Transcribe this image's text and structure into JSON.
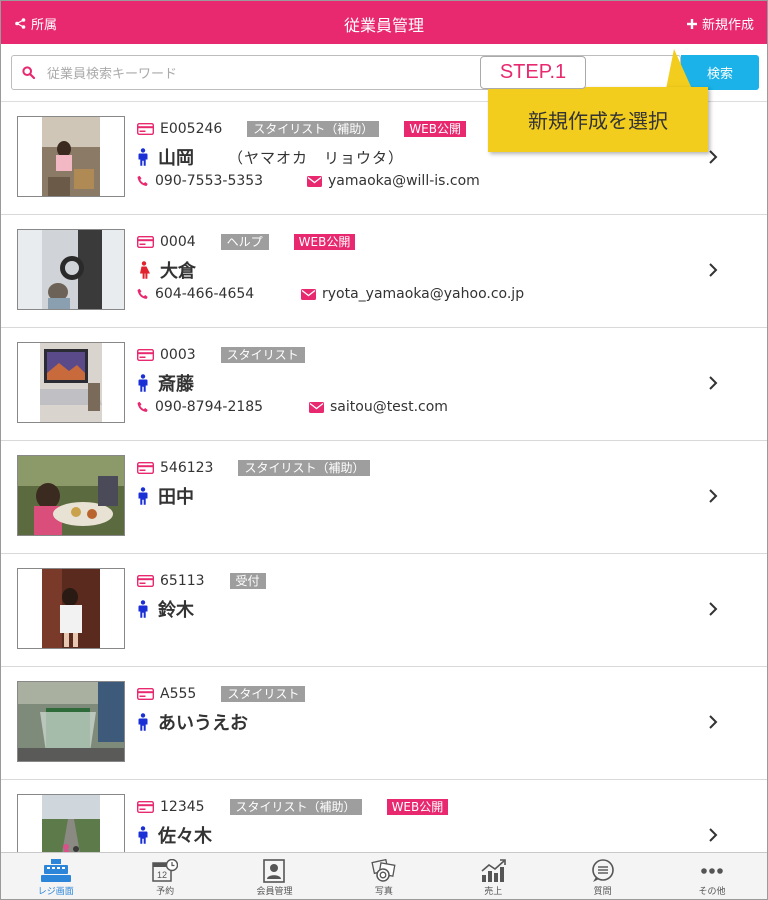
{
  "header": {
    "left_label": "所属",
    "title": "従業員管理",
    "right_label": "新規作成"
  },
  "search": {
    "placeholder": "従業員検索キーワード",
    "button_label": "検索"
  },
  "tutorial": {
    "step": "STEP.1",
    "message": "新規作成を選択"
  },
  "employees": [
    {
      "code": "E005246",
      "role": "スタイリスト（補助）",
      "web": "WEB公開",
      "gender": "male",
      "name": "山岡",
      "kana": "（ヤマオカ　リョウタ）",
      "phone": "090-7553-5353",
      "email": "yamaoka@will-is.com"
    },
    {
      "code": "0004",
      "role": "ヘルプ",
      "web": "WEB公開",
      "gender": "female",
      "name": "大倉",
      "kana": "",
      "phone": "604-466-4654",
      "email": "ryota_yamaoka@yahoo.co.jp"
    },
    {
      "code": "0003",
      "role": "スタイリスト",
      "web": "",
      "gender": "male",
      "name": "斎藤",
      "kana": "",
      "phone": "090-8794-2185",
      "email": "saitou@test.com"
    },
    {
      "code": "546123",
      "role": "スタイリスト（補助）",
      "web": "",
      "gender": "male",
      "name": "田中",
      "kana": "",
      "phone": "",
      "email": ""
    },
    {
      "code": "65113",
      "role": "受付",
      "web": "",
      "gender": "male",
      "name": "鈴木",
      "kana": "",
      "phone": "",
      "email": ""
    },
    {
      "code": "A555",
      "role": "スタイリスト",
      "web": "",
      "gender": "male",
      "name": "あいうえお",
      "kana": "",
      "phone": "",
      "email": ""
    },
    {
      "code": "12345",
      "role": "スタイリスト（補助）",
      "web": "WEB公開",
      "gender": "male",
      "name": "佐々木",
      "kana": "",
      "phone": "",
      "email": ""
    }
  ],
  "bottom_nav": [
    {
      "label": "レジ画面",
      "icon": "register-icon",
      "active": true
    },
    {
      "label": "予約",
      "icon": "calendar-icon",
      "active": false
    },
    {
      "label": "会員管理",
      "icon": "member-icon",
      "active": false
    },
    {
      "label": "写真",
      "icon": "camera-icon",
      "active": false
    },
    {
      "label": "売上",
      "icon": "chart-icon",
      "active": false
    },
    {
      "label": "質問",
      "icon": "chat-icon",
      "active": false
    },
    {
      "label": "その他",
      "icon": "more-icon",
      "active": false
    }
  ],
  "colors": {
    "brand": "#e8296f",
    "search_button": "#1ab2e8",
    "male_icon": "#1a2fd6",
    "female_icon": "#e0232c",
    "callout": "#f2cd1d",
    "active_nav": "#2b86d9"
  }
}
